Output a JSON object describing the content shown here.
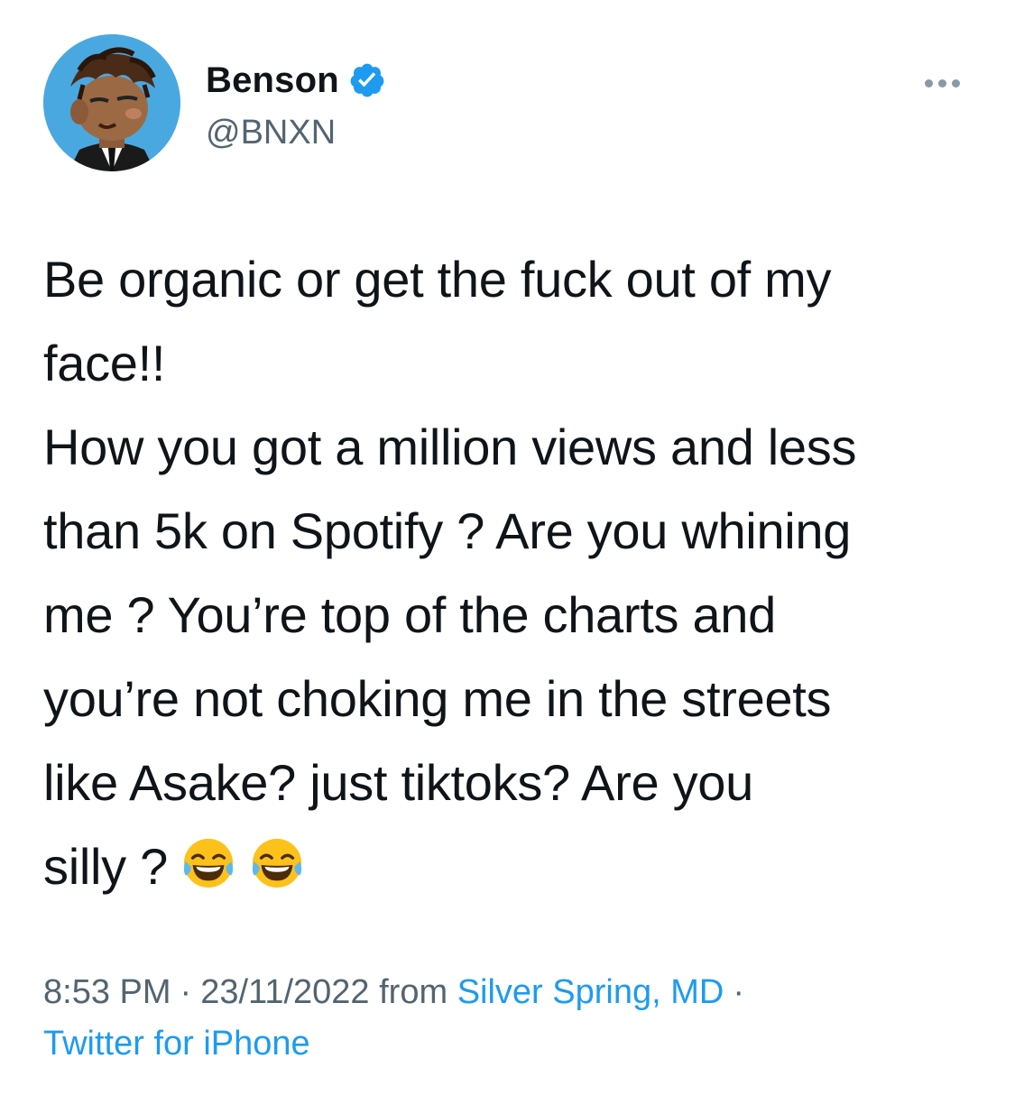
{
  "author": {
    "display_name": "Benson",
    "handle": "@BNXN",
    "verified": true
  },
  "tweet": {
    "lines": [
      "Be organic or get the fuck out of my",
      "face!!",
      "How you got a million views and less",
      "than 5k on Spotify ? Are you whining",
      "me ? You’re top of the charts and",
      "you’re not choking me in the streets",
      "like Asake? just tiktoks? Are you",
      "silly ?"
    ],
    "emoji": [
      "face-with-tears-of-joy",
      "face-with-tears-of-joy"
    ]
  },
  "meta": {
    "time": "8:53 PM",
    "separator": "·",
    "date": "23/11/2022",
    "from_label": "from",
    "location": "Silver Spring, MD",
    "client": "Twitter for iPhone"
  },
  "icons": {
    "more": "more-horizontal-icon",
    "verified": "verified-badge-icon"
  },
  "colors": {
    "accent": "#1d9bf0",
    "verified_blue": "#1d9bf0",
    "secondary_text": "#536471",
    "avatar_bg": "#4aa8e0"
  }
}
